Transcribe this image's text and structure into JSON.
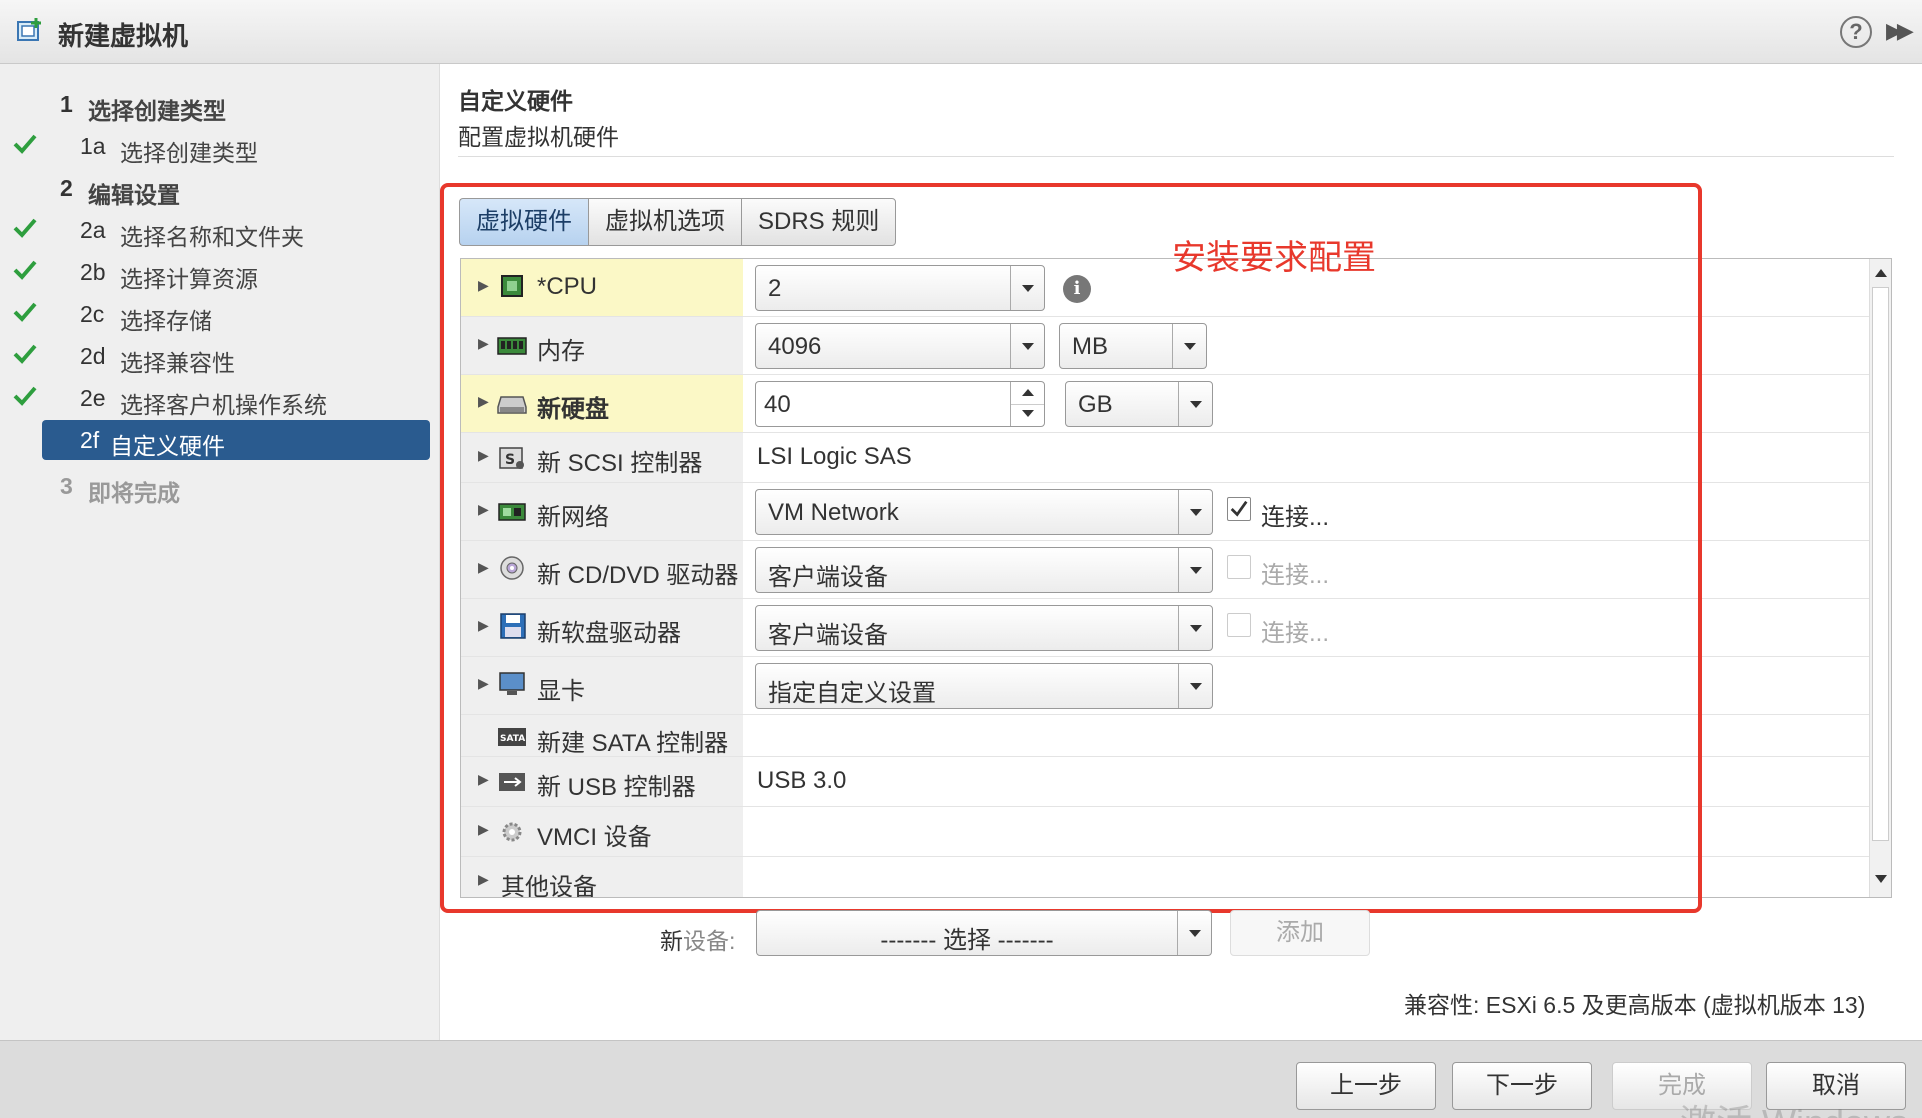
{
  "window": {
    "title": "新建虚拟机",
    "icon": "new-vm-icon",
    "help_icon": "help-icon",
    "expand_icon": "double-chevron-right-icon"
  },
  "sidebar": {
    "steps": [
      {
        "num": "1",
        "label": "选择创建类型",
        "type": "major",
        "checked": false
      },
      {
        "num": "1a",
        "label": "选择创建类型",
        "type": "minor",
        "checked": true
      },
      {
        "num": "2",
        "label": "编辑设置",
        "type": "major",
        "checked": false
      },
      {
        "num": "2a",
        "label": "选择名称和文件夹",
        "type": "minor",
        "checked": true
      },
      {
        "num": "2b",
        "label": "选择计算资源",
        "type": "minor",
        "checked": true
      },
      {
        "num": "2c",
        "label": "选择存储",
        "type": "minor",
        "checked": true
      },
      {
        "num": "2d",
        "label": "选择兼容性",
        "type": "minor",
        "checked": true
      },
      {
        "num": "2e",
        "label": "选择客户机操作系统",
        "type": "minor",
        "checked": true
      },
      {
        "num": "2f",
        "label": "自定义硬件",
        "type": "active",
        "checked": false
      },
      {
        "num": "3",
        "label": "即将完成",
        "type": "muted",
        "checked": false
      }
    ],
    "check_color": "#2e9e3e",
    "active_color": "#2a5b8f"
  },
  "main": {
    "title": "自定义硬件",
    "subtitle": "配置虚拟机硬件",
    "annotation": "安装要求配置",
    "annotation_color": "#e8382c",
    "tabs": [
      {
        "label": "虚拟硬件",
        "selected": true
      },
      {
        "label": "虚拟机选项",
        "selected": false
      },
      {
        "label": "SDRS 规则",
        "selected": false
      }
    ],
    "hardware": {
      "cpu": {
        "name": "*CPU",
        "value": "2",
        "icon": "cpu-icon",
        "info_icon": "info-icon"
      },
      "memory": {
        "name": "内存",
        "value": "4096",
        "unit": "MB",
        "icon": "memory-icon"
      },
      "disk": {
        "name": "新硬盘",
        "value": "40",
        "unit": "GB",
        "icon": "hard-disk-icon"
      },
      "scsi": {
        "name": "新 SCSI 控制器",
        "value": "LSI Logic SAS",
        "icon": "scsi-controller-icon"
      },
      "network": {
        "name": "新网络",
        "value": "VM Network",
        "connect_label": "连接...",
        "connected": true,
        "icon": "network-adapter-icon"
      },
      "cdrom": {
        "name": "新 CD/DVD 驱动器",
        "value": "客户端设备",
        "connect_label": "连接...",
        "connected": false,
        "icon": "cd-dvd-icon"
      },
      "floppy": {
        "name": "新软盘驱动器",
        "value": "客户端设备",
        "connect_label": "连接...",
        "connected": false,
        "icon": "floppy-icon"
      },
      "video": {
        "name": "显卡",
        "value": "指定自定义设置",
        "icon": "video-card-icon"
      },
      "sata": {
        "name": "新建 SATA 控制器",
        "icon": "sata-controller-icon"
      },
      "usb": {
        "name": "新 USB 控制器",
        "value": "USB 3.0",
        "icon": "usb-icon"
      },
      "vmci": {
        "name": "VMCI 设备",
        "icon": "vmci-gear-icon"
      },
      "other": {
        "name": "其他设备"
      }
    },
    "new_device": {
      "label_a": "新",
      "label_b": "设备:",
      "select_value": "------- 选择 -------",
      "add_label": "添加"
    },
    "compatibility": "兼容性: ESXi 6.5 及更高版本 (虚拟机版本 13)"
  },
  "footer": {
    "back": "上一步",
    "next": "下一步",
    "finish": "完成",
    "cancel": "取消",
    "watermark": "激活 Windows"
  }
}
